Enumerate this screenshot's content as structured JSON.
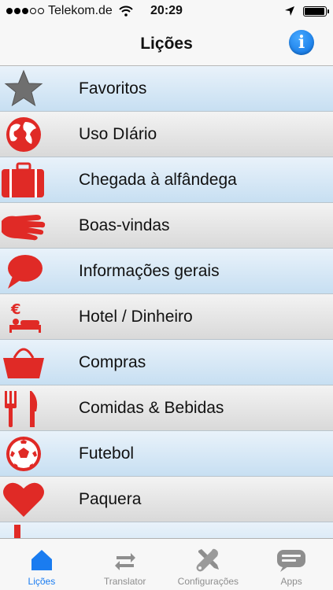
{
  "status_bar": {
    "signal_bars_filled": 3,
    "signal_bars_total": 5,
    "carrier": "Telekom.de",
    "time": "20:29",
    "battery_level": 0.95
  },
  "nav": {
    "title": "Lições",
    "info_icon": "info-icon"
  },
  "lessons": [
    {
      "label": "Favoritos",
      "icon": "star-icon"
    },
    {
      "label": "Uso DIário",
      "icon": "globe-icon"
    },
    {
      "label": "Chegada à alfândega",
      "icon": "suitcase-icon"
    },
    {
      "label": "Boas-vindas",
      "icon": "hand-icon"
    },
    {
      "label": "Informações gerais",
      "icon": "speech-bubble-icon"
    },
    {
      "label": "Hotel / Dinheiro",
      "icon": "hotel-money-icon"
    },
    {
      "label": "Compras",
      "icon": "shopping-basket-icon"
    },
    {
      "label": "Comidas & Bebidas",
      "icon": "fork-knife-icon"
    },
    {
      "label": "Futebol",
      "icon": "soccer-ball-icon"
    },
    {
      "label": "Paquera",
      "icon": "heart-icon"
    }
  ],
  "tabs": [
    {
      "label": "Lições",
      "icon": "home-icon",
      "active": true
    },
    {
      "label": "Translator",
      "icon": "swap-arrows-icon",
      "active": false
    },
    {
      "label": "Configurações",
      "icon": "tools-icon",
      "active": false
    },
    {
      "label": "Apps",
      "icon": "isayhello-logo-icon",
      "active": false
    }
  ],
  "colors": {
    "accent": "#1a7cf0",
    "icon_red": "#e02a26",
    "row_blue": "#c7dff2",
    "row_gray": "#d9d9d9"
  }
}
